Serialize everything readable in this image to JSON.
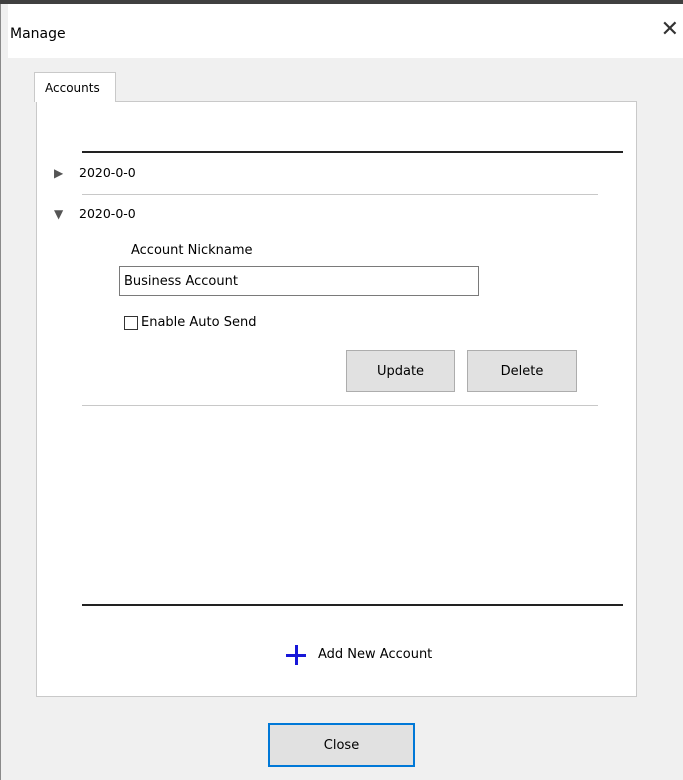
{
  "window": {
    "title": "Manage",
    "close_glyph": "✕"
  },
  "tabs": [
    {
      "label": "Accounts",
      "selected": true
    }
  ],
  "accounts": [
    {
      "label": "2020-0-0",
      "expanded": false,
      "arrow": "▶"
    },
    {
      "label": "2020-0-0",
      "expanded": true,
      "arrow": "▼",
      "nickname_label": "Account Nickname",
      "nickname_value": "Business Account",
      "auto_send_label": "Enable Auto Send",
      "auto_send_checked": false,
      "update_label": "Update",
      "delete_label": "Delete"
    }
  ],
  "add_account": {
    "label": "Add New Account",
    "icon": "plus-icon",
    "icon_color": "#1717d8"
  },
  "footer": {
    "close_label": "Close"
  },
  "colors": {
    "accent_border": "#0078d7",
    "button_bg": "#e1e1e1"
  }
}
